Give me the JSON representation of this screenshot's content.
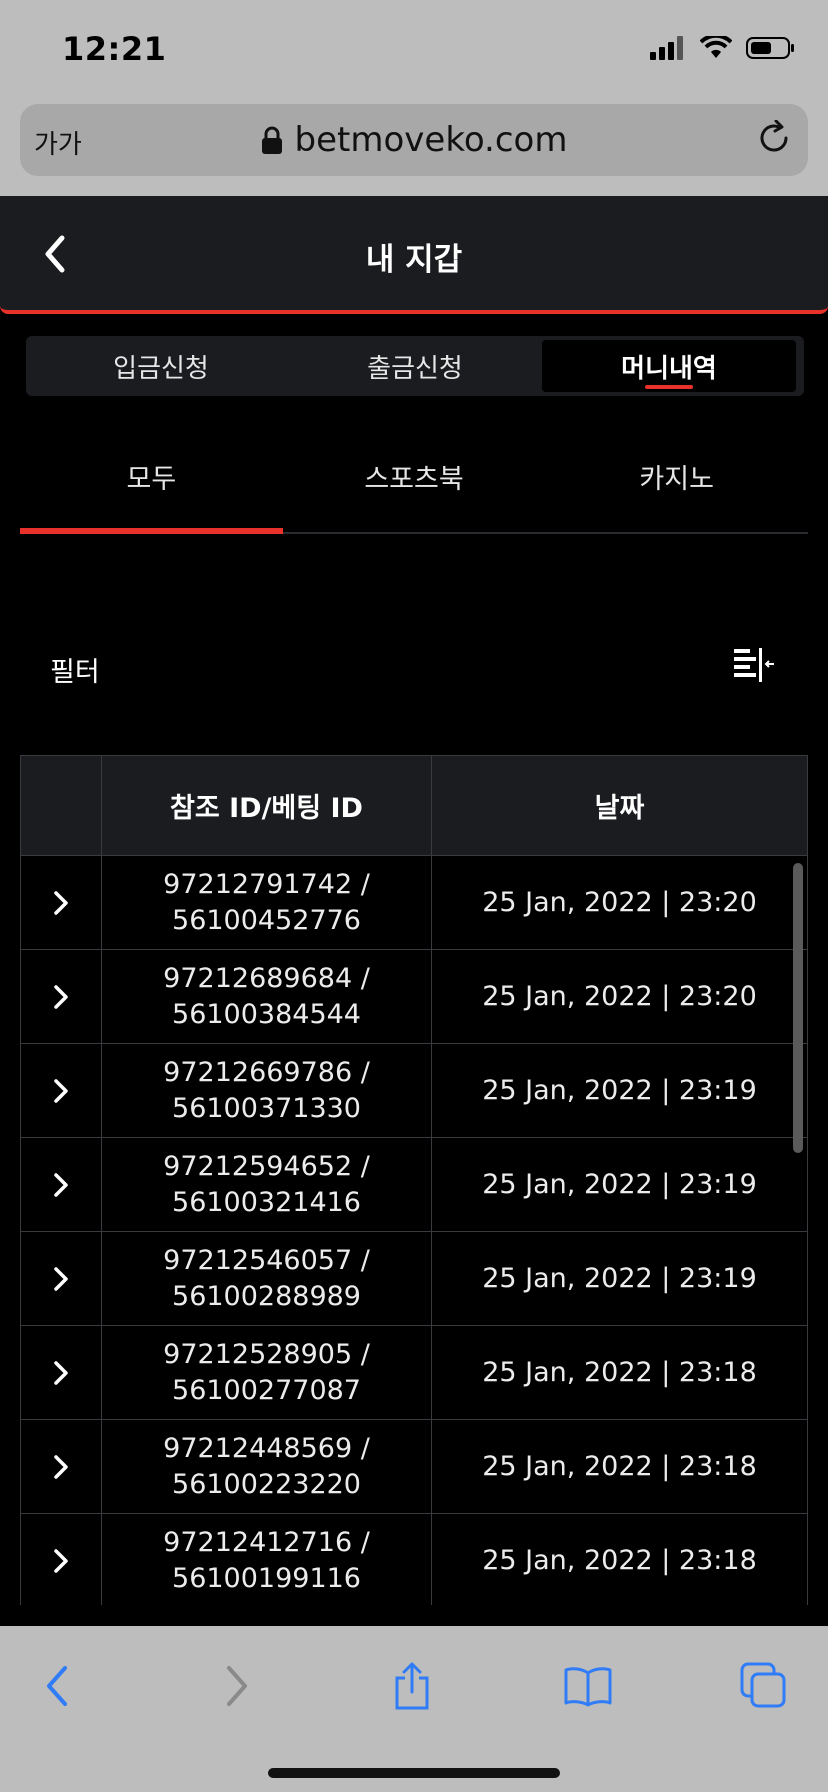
{
  "status_bar": {
    "time": "12:21"
  },
  "browser": {
    "text_size_label": "가가",
    "url": "betmoveko.com"
  },
  "header": {
    "title": "내 지갑"
  },
  "wallet_tabs": [
    {
      "label": "입금신청",
      "active": false
    },
    {
      "label": "출금신청",
      "active": false
    },
    {
      "label": "머니내역",
      "active": true
    }
  ],
  "sub_tabs": [
    {
      "label": "모두",
      "active": true
    },
    {
      "label": "스포츠북",
      "active": false
    },
    {
      "label": "카지노",
      "active": false
    }
  ],
  "filter": {
    "label": "필터"
  },
  "table": {
    "headers": [
      "",
      "참조 ID/베팅 ID",
      "날짜"
    ],
    "rows": [
      {
        "ref_id": "97212791742 /",
        "bet_id": "56100452776",
        "date": "25 Jan, 2022 | 23:20"
      },
      {
        "ref_id": "97212689684 /",
        "bet_id": "56100384544",
        "date": "25 Jan, 2022 | 23:20"
      },
      {
        "ref_id": "97212669786 /",
        "bet_id": "56100371330",
        "date": "25 Jan, 2022 | 23:19"
      },
      {
        "ref_id": "97212594652 /",
        "bet_id": "56100321416",
        "date": "25 Jan, 2022 | 23:19"
      },
      {
        "ref_id": "97212546057 /",
        "bet_id": "56100288989",
        "date": "25 Jan, 2022 | 23:19"
      },
      {
        "ref_id": "97212528905 /",
        "bet_id": "56100277087",
        "date": "25 Jan, 2022 | 23:18"
      },
      {
        "ref_id": "97212448569 /",
        "bet_id": "56100223220",
        "date": "25 Jan, 2022 | 23:18"
      },
      {
        "ref_id": "97212412716 /",
        "bet_id": "56100199116",
        "date": "25 Jan, 2022 | 23:18"
      }
    ]
  },
  "colors": {
    "accent": "#e8312a",
    "surface": "#1b1c1f",
    "ios_blue": "#2f7cf6"
  },
  "icons": [
    "signal-icon",
    "wifi-icon",
    "battery-icon",
    "lock-icon",
    "reload-icon",
    "back-chevron-icon",
    "filter-icon",
    "row-chevron-icon",
    "browser-back-icon",
    "browser-forward-icon",
    "share-icon",
    "bookmarks-icon",
    "tabs-icon"
  ]
}
